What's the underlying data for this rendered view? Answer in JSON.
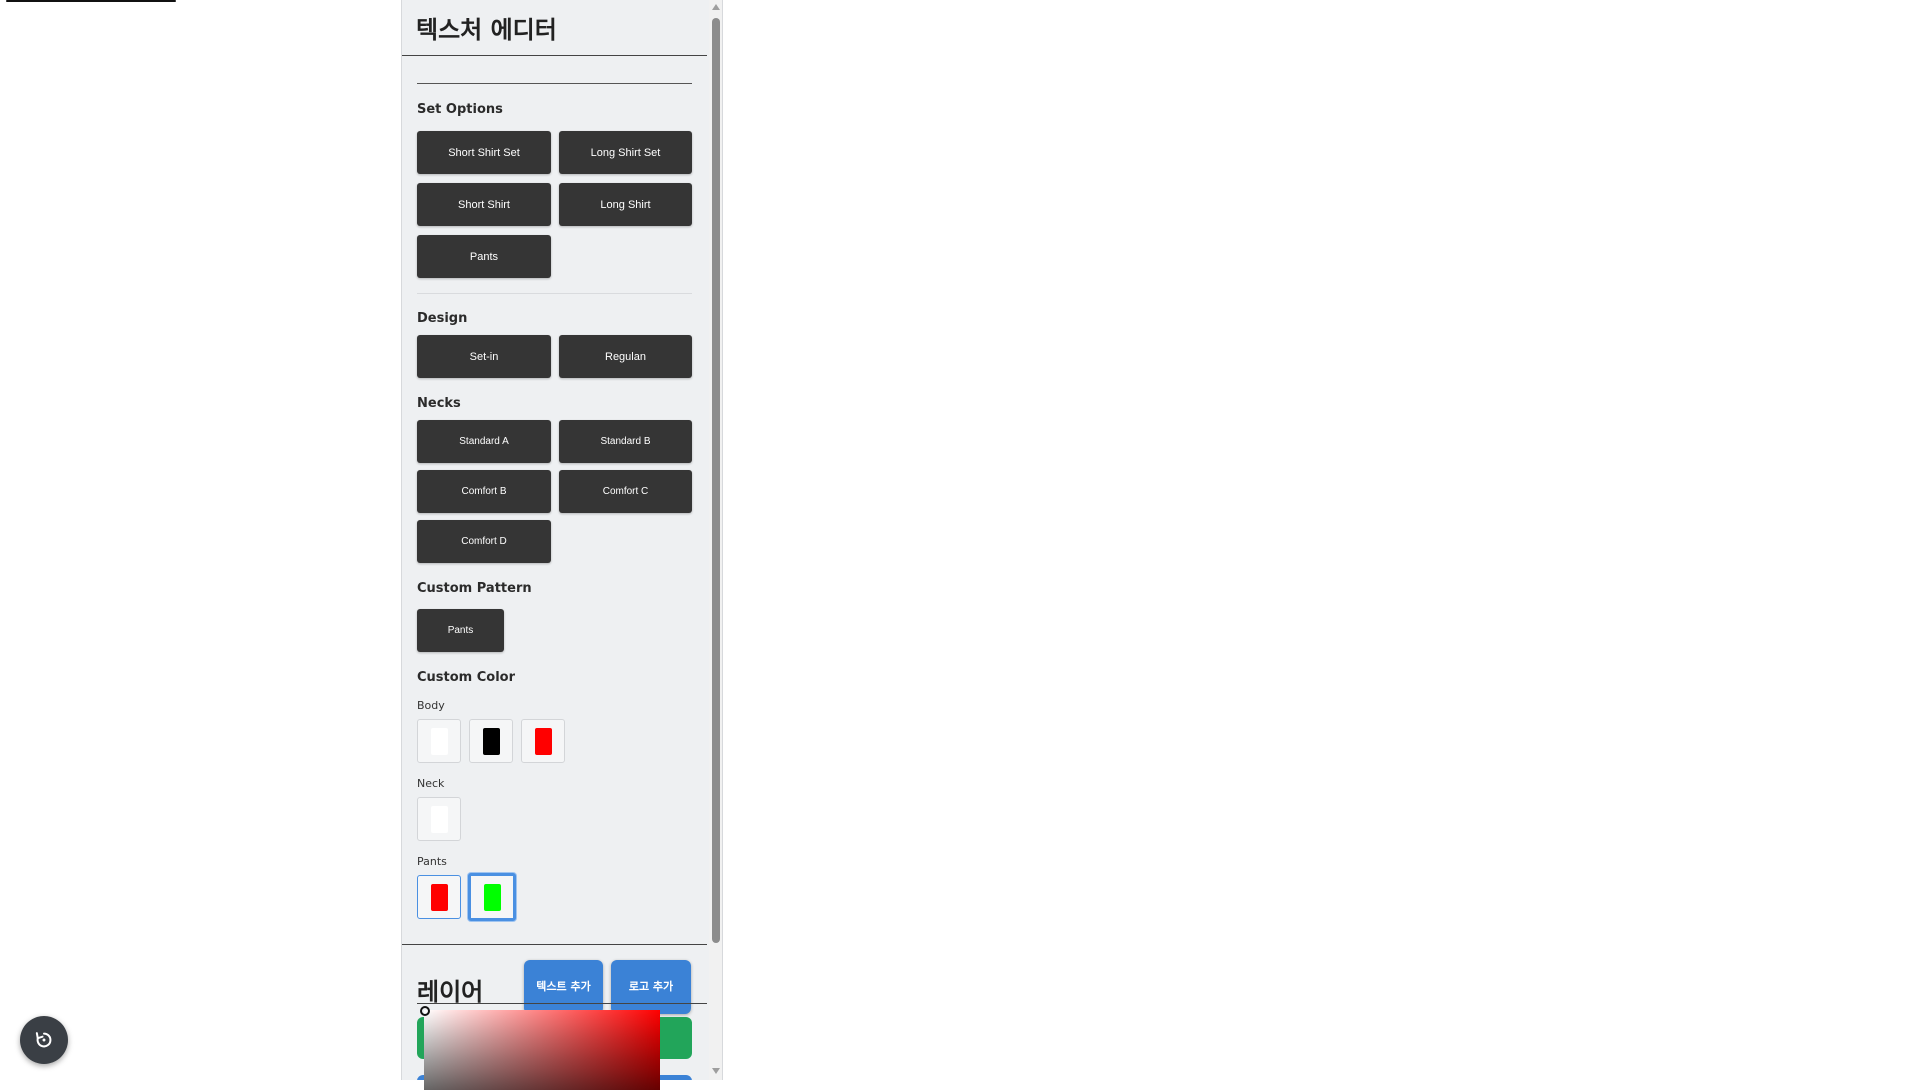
{
  "panel": {
    "title": "텍스처 에디터"
  },
  "set_options": {
    "label": "Set Options",
    "buttons": [
      "Short Shirt Set",
      "Long Shirt Set",
      "Short Shirt",
      "Long Shirt",
      "Pants"
    ]
  },
  "design": {
    "label": "Design",
    "buttons": [
      "Set-in",
      "Regulan"
    ]
  },
  "necks": {
    "label": "Necks",
    "buttons": [
      "Standard A",
      "Standard B",
      "Comfort B",
      "Comfort C",
      "Comfort D"
    ]
  },
  "custom_pattern": {
    "label": "Custom Pattern",
    "buttons": [
      "Pants"
    ]
  },
  "custom_color": {
    "label": "Custom Color",
    "body": {
      "label": "Body",
      "colors": [
        "#ffffff",
        "#000000",
        "#ff0000"
      ]
    },
    "neck": {
      "label": "Neck",
      "colors": [
        "#ffffff"
      ]
    },
    "pants": {
      "label": "Pants",
      "colors": [
        "#ff0000",
        "#00ff00"
      ],
      "selected_index": 1
    }
  },
  "layers": {
    "title": "레이어",
    "add_text_label": "텍스트 추가",
    "add_logo_label": "로고 추가"
  },
  "color_picker": {
    "hue": "#ff0000"
  },
  "icons": {
    "reset": "reset-icon",
    "scroll_up": "arrow-up-icon",
    "scroll_down": "arrow-down-icon"
  }
}
